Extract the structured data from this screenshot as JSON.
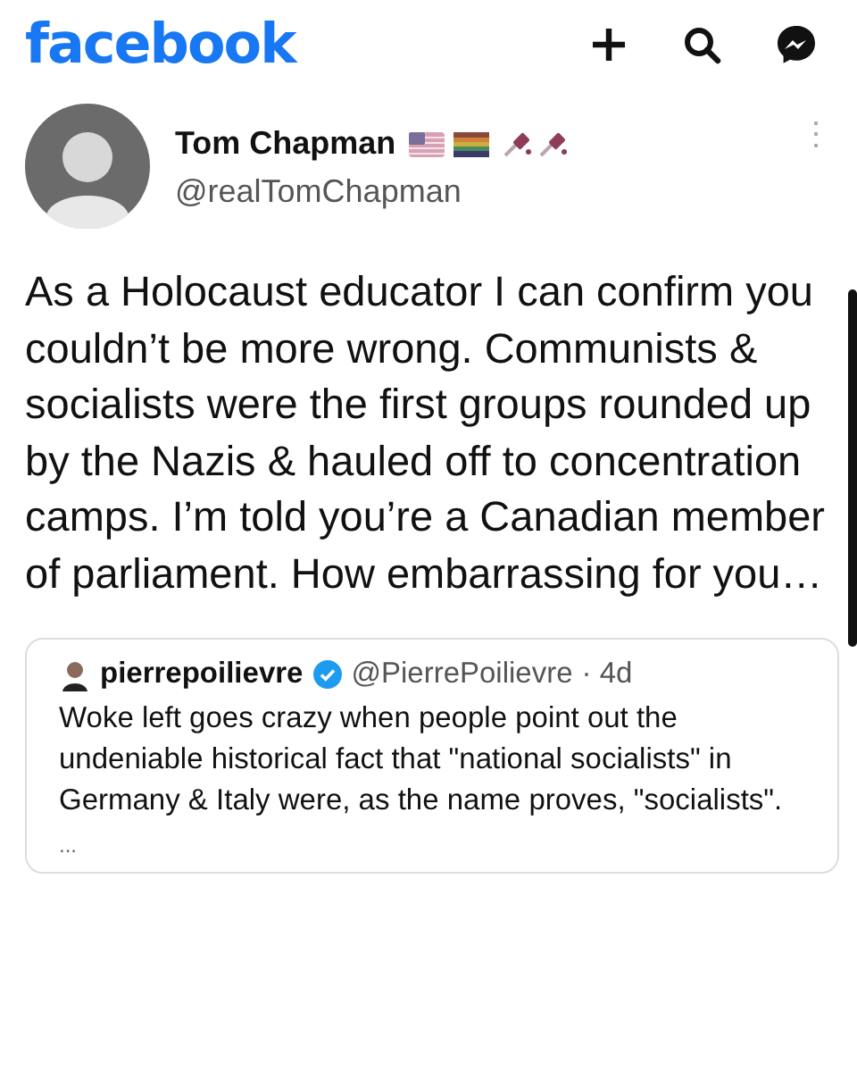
{
  "app_bar": {
    "logo": "facebook"
  },
  "post": {
    "author": "Tom Chapman",
    "handle": "@realTomChapman",
    "more": "⋮",
    "text": "As a Holocaust educator I can confirm you couldn’t be more wrong. Communists & socialists were the first groups rounded up by the Nazis & hauled off to concentration camps. I’m told you’re a Canadian member of parliament. How embarrassing for you…",
    "quoted": {
      "author": "pierrepoilievre",
      "verified": true,
      "handle": "@PierrePoilievre",
      "time": "· 4d",
      "text": "Woke left goes crazy when people point out the undeniable historical fact that \"national socialists\" in Germany & Italy were, as the name proves, \"socialists\".",
      "more": "..."
    }
  }
}
